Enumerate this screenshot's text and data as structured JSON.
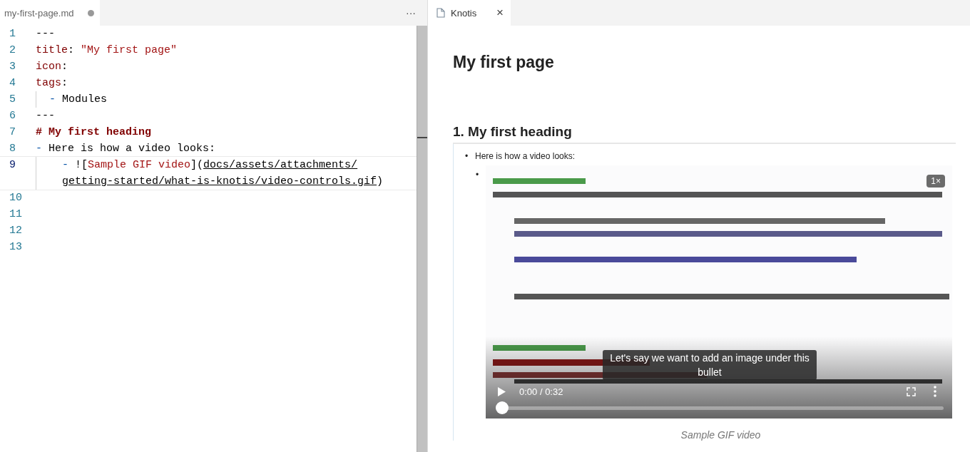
{
  "editor": {
    "tab": {
      "label": "my-first-page.md",
      "modified": true
    },
    "more": "···",
    "lines": [
      {
        "number": "1",
        "active": false,
        "tokens": [
          {
            "kind": "punct",
            "text": "---"
          }
        ]
      },
      {
        "number": "2",
        "active": false,
        "tokens": [
          {
            "kind": "key",
            "text": "title"
          },
          {
            "kind": "punct",
            "text": ": "
          },
          {
            "kind": "string",
            "text": "\"My first page\""
          }
        ]
      },
      {
        "number": "3",
        "active": false,
        "tokens": [
          {
            "kind": "key",
            "text": "icon"
          },
          {
            "kind": "punct",
            "text": ":"
          }
        ]
      },
      {
        "number": "4",
        "active": false,
        "tokens": [
          {
            "kind": "key",
            "text": "tags"
          },
          {
            "kind": "punct",
            "text": ":"
          }
        ]
      },
      {
        "number": "5",
        "active": false,
        "guide": true,
        "tokens": [
          {
            "kind": "dash",
            "text": "  - "
          },
          {
            "kind": "plain",
            "text": "Modules"
          }
        ]
      },
      {
        "number": "6",
        "active": false,
        "tokens": [
          {
            "kind": "punct",
            "text": "---"
          }
        ]
      },
      {
        "number": "7",
        "active": false,
        "tokens": [
          {
            "kind": "heading",
            "text": "# My first heading"
          }
        ]
      },
      {
        "number": "8",
        "active": false,
        "tokens": [
          {
            "kind": "dash",
            "text": "- "
          },
          {
            "kind": "plain",
            "text": "Here is how a video looks:"
          }
        ]
      },
      {
        "number": "9",
        "active": true,
        "guide": true,
        "tokens": [
          {
            "kind": "dash",
            "text": "    - "
          },
          {
            "kind": "plain",
            "text": "!["
          },
          {
            "kind": "link",
            "text": "Sample GIF video"
          },
          {
            "kind": "plain",
            "text": "]("
          },
          {
            "kind": "url",
            "text": "docs/assets/attachments/"
          },
          {
            "kind": "break"
          },
          {
            "kind": "url",
            "text": "getting-started/what-is-knotis/video-controls.gif"
          },
          {
            "kind": "plain",
            "text": ")"
          }
        ]
      },
      {
        "number": "10",
        "active": false
      },
      {
        "number": "11",
        "active": false
      },
      {
        "number": "12",
        "active": false
      },
      {
        "number": "13",
        "active": false
      }
    ]
  },
  "preview": {
    "tab": {
      "label": "Knotis",
      "close": "×"
    },
    "title": "My first page",
    "heading": "1. My first heading",
    "bullet": {
      "marker": "•",
      "text": "Here is how a video looks:"
    },
    "video_marker": "•",
    "video": {
      "kind": "picture",
      "speed": "1×",
      "subtitle": "Let's say we want to add an image under this bullet",
      "time": "0:00 / 0:32",
      "level": 0
    },
    "caption": "Sample GIF video"
  }
}
